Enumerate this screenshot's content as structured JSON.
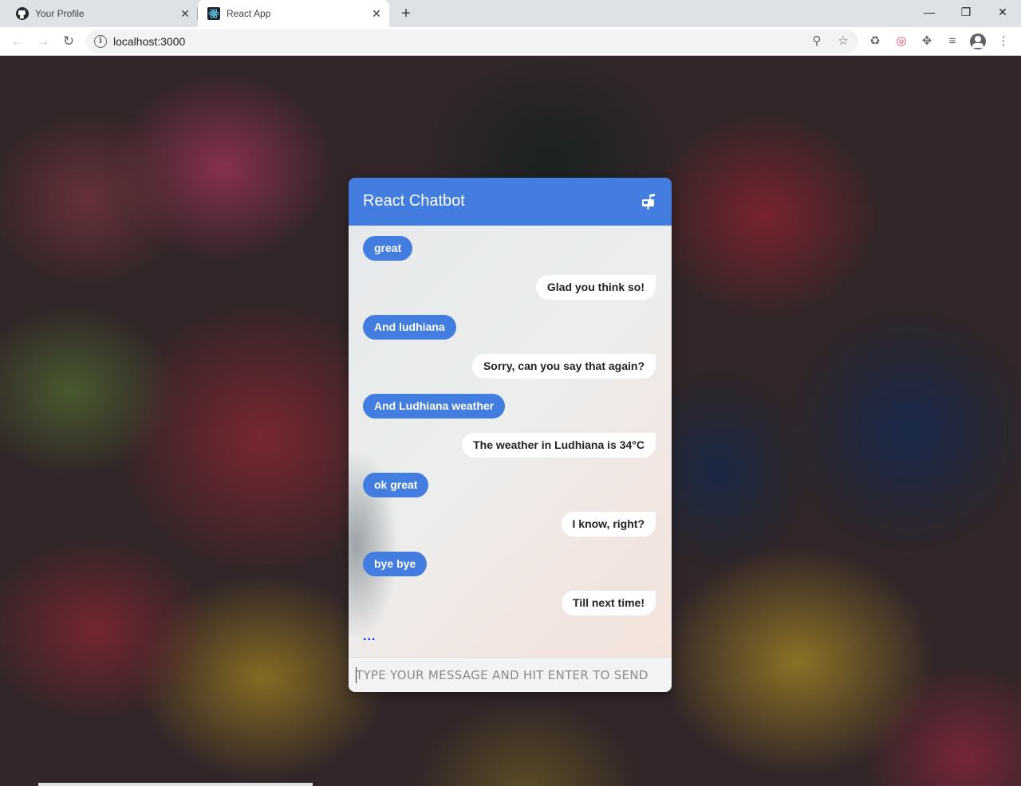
{
  "browser": {
    "tabs": [
      {
        "title": "Your Profile",
        "icon": "github-icon"
      },
      {
        "title": "React App",
        "icon": "react-icon",
        "active": true
      }
    ],
    "url": "localhost:3000"
  },
  "chatbot": {
    "title": "React Chatbot",
    "header_color": "#437de0",
    "messages": [
      {
        "sender": "user",
        "text": "great"
      },
      {
        "sender": "bot",
        "text": "Glad you think so!"
      },
      {
        "sender": "user",
        "text": "And ludhiana"
      },
      {
        "sender": "bot",
        "text": "Sorry, can you say that again?"
      },
      {
        "sender": "user",
        "text": "And Ludhiana weather"
      },
      {
        "sender": "bot",
        "text": "The weather in Ludhiana is 34°C"
      },
      {
        "sender": "user",
        "text": "ok great"
      },
      {
        "sender": "bot",
        "text": "I know, right?"
      },
      {
        "sender": "user",
        "text": "bye bye"
      },
      {
        "sender": "bot",
        "text": "Till next time!"
      }
    ],
    "typing_indicator": "...",
    "input_placeholder": "TYPE YOUR MESSAGE AND HIT ENTER TO SEND"
  }
}
